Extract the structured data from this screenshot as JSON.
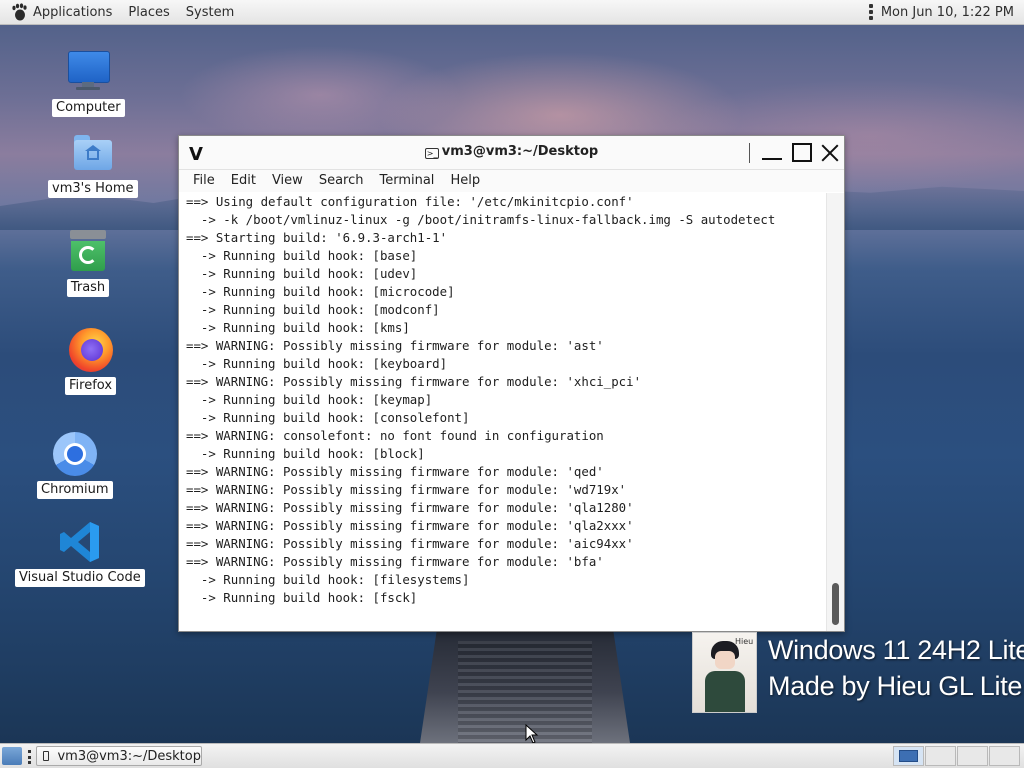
{
  "topbar": {
    "applications": "Applications",
    "places": "Places",
    "system": "System",
    "clock": "Mon Jun 10,  1:22 PM"
  },
  "desktop_icons": [
    {
      "label": "Computer",
      "icon": "computer-icon"
    },
    {
      "label": "vm3's Home",
      "icon": "home-folder-icon"
    },
    {
      "label": "Trash",
      "icon": "trash-icon"
    },
    {
      "label": "Firefox",
      "icon": "firefox-icon"
    },
    {
      "label": "Chromium",
      "icon": "chromium-icon"
    },
    {
      "label": "Visual Studio Code",
      "icon": "vscode-icon"
    }
  ],
  "terminal": {
    "app_logo": "V",
    "title": "vm3@vm3:~/Desktop",
    "menu": [
      "File",
      "Edit",
      "View",
      "Search",
      "Terminal",
      "Help"
    ],
    "lines": [
      "==> Using default configuration file: '/etc/mkinitcpio.conf'",
      "  -> -k /boot/vmlinuz-linux -g /boot/initramfs-linux-fallback.img -S autodetect",
      "==> Starting build: '6.9.3-arch1-1'",
      "  -> Running build hook: [base]",
      "  -> Running build hook: [udev]",
      "  -> Running build hook: [microcode]",
      "  -> Running build hook: [modconf]",
      "  -> Running build hook: [kms]",
      "==> WARNING: Possibly missing firmware for module: 'ast'",
      "  -> Running build hook: [keyboard]",
      "==> WARNING: Possibly missing firmware for module: 'xhci_pci'",
      "  -> Running build hook: [keymap]",
      "  -> Running build hook: [consolefont]",
      "==> WARNING: consolefont: no font found in configuration",
      "  -> Running build hook: [block]",
      "==> WARNING: Possibly missing firmware for module: 'qed'",
      "==> WARNING: Possibly missing firmware for module: 'wd719x'",
      "==> WARNING: Possibly missing firmware for module: 'qla1280'",
      "==> WARNING: Possibly missing firmware for module: 'qla2xxx'",
      "==> WARNING: Possibly missing firmware for module: 'aic94xx'",
      "==> WARNING: Possibly missing firmware for module: 'bfa'",
      "  -> Running build hook: [filesystems]",
      "  -> Running build hook: [fsck]"
    ]
  },
  "watermark": {
    "line1": "Windows 11 24H2 Lite",
    "line2": "Made by Hieu GL Lite",
    "photo_tag": "Hieu"
  },
  "taskbar": {
    "task_label": "vm3@vm3:~/Desktop",
    "workspaces": 4,
    "active_workspace": 1
  }
}
